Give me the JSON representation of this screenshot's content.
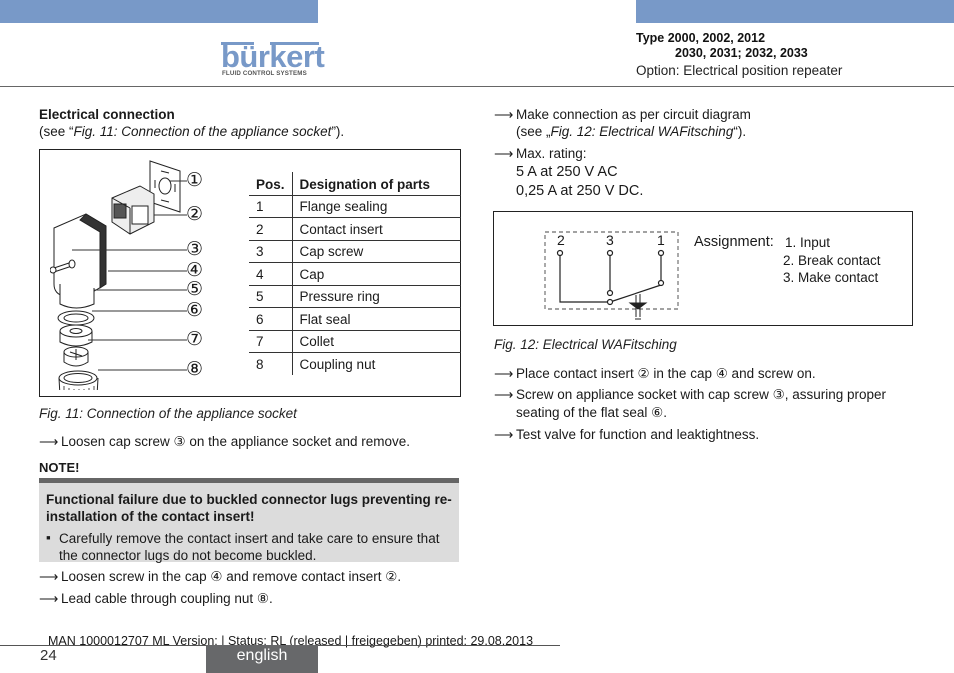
{
  "header": {
    "brand": {
      "name": "bürkert",
      "tagline": "FLUID CONTROL SYSTEMS",
      "color": "#7899c8"
    },
    "type_line1": "Type 2000, 2002, 2012",
    "type_line2": "2030, 2031; 2032, 2033",
    "option": "Option: Electrical position repeater"
  },
  "left": {
    "section_title": "Electrical connection",
    "section_ref_prefix": "(see “",
    "section_ref_fig": "Fig. 11: Connection of the appliance socket",
    "section_ref_suffix": "”).",
    "figure11": {
      "callouts": [
        "①",
        "②",
        "③",
        "④",
        "⑤",
        "⑥",
        "⑦",
        "⑧"
      ],
      "table": {
        "headers": [
          "Pos.",
          "Designation of parts"
        ],
        "rows": [
          [
            "1",
            "Flange sealing"
          ],
          [
            "2",
            "Contact insert"
          ],
          [
            "3",
            "Cap screw"
          ],
          [
            "4",
            "Cap"
          ],
          [
            "5",
            "Pressure ring"
          ],
          [
            "6",
            "Flat seal"
          ],
          [
            "7",
            "Collet"
          ],
          [
            "8",
            "Coupling nut"
          ]
        ]
      },
      "caption": "Fig. 11:  Connection of the appliance socket"
    },
    "step_loosen_cap": "Loosen cap screw ③ on the appliance socket and remove.",
    "note": {
      "label": "NOTE!",
      "heading": "Functional failure due to buckled connector lugs preventing re-installation of the contact insert!",
      "bullet_mark": "▪",
      "bullet": "Carefully remove the contact insert and take care to ensure that the connector lugs do not become buckled."
    },
    "steps_after": [
      "Loosen screw in the cap ④ and remove contact insert ②.",
      "Lead cable through coupling nut ⑧."
    ]
  },
  "right": {
    "step_connection": "Make connection as per circuit diagram",
    "step_connection_ref_prefix": "(see „",
    "step_connection_ref_fig": "Fig. 12: Electrical WAFitsching",
    "step_connection_ref_suffix": "“).",
    "step_rating": "Max. rating:",
    "rating_ac": "5 A at 250 V AC",
    "rating_dc": "0,25 A at 250 V DC.",
    "figure12": {
      "terminal_labels": [
        "2",
        "3",
        "1"
      ],
      "assignment_label": "Assignment:",
      "assignments": [
        "1. Input",
        "2. Break contact",
        "3. Make contact"
      ],
      "caption": "Fig. 12:  Electrical WAFitsching"
    },
    "steps_after": [
      "Place contact insert ② in the cap ④ and screw on.",
      "Screw on appliance socket with cap screw ③, assuring proper",
      "seating of the flat seal ⑥.",
      "Test valve for function and leaktightness."
    ]
  },
  "arrow_glyph": "⟶",
  "footer": {
    "meta": "MAN  1000012707  ML  Version: | Status: RL (released | freigegeben)  printed: 29.08.2013",
    "page_number": "24",
    "language": "english"
  }
}
